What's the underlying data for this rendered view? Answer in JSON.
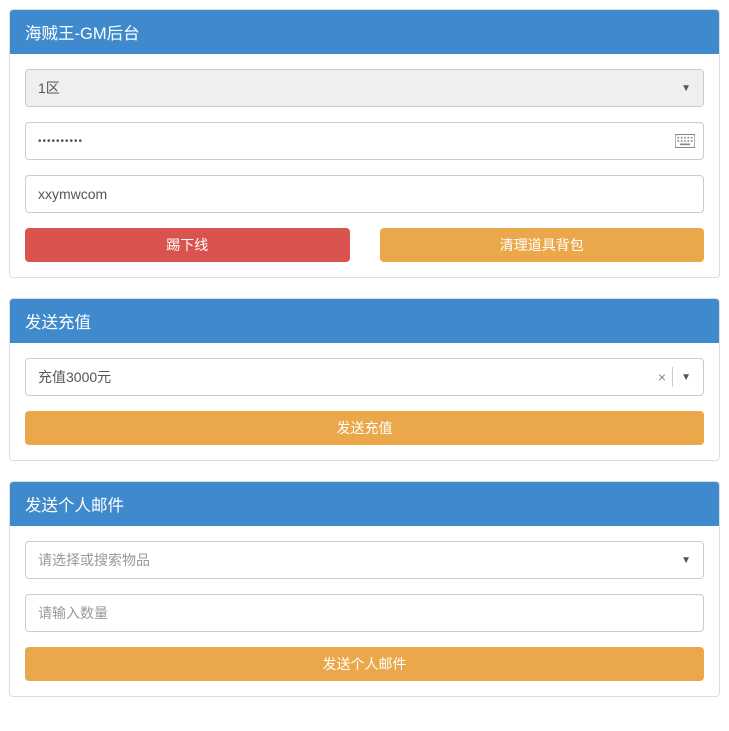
{
  "panel1": {
    "title": "海贼王-GM后台",
    "zone_selected": "1区",
    "password_masked": "••••••••••",
    "username_value": "xxymwcom",
    "kick_button": "踢下线",
    "clear_bag_button": "清理道具背包"
  },
  "panel2": {
    "title": "发送充值",
    "recharge_selected": "充值3000元",
    "send_recharge_button": "发送充值"
  },
  "panel3": {
    "title": "发送个人邮件",
    "item_placeholder": "请选择或搜索物品",
    "quantity_placeholder": "请输入数量",
    "send_mail_button": "发送个人邮件"
  }
}
